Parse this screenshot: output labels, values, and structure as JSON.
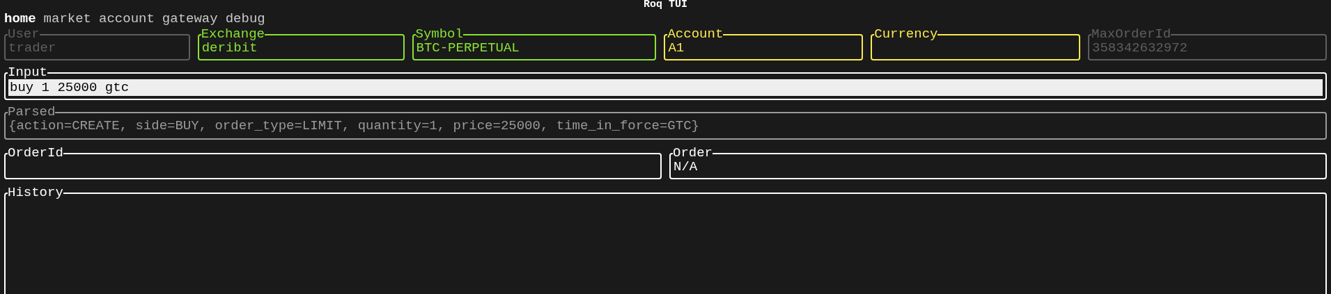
{
  "window": {
    "title": "Roq TUI"
  },
  "tabs": [
    {
      "label": "home",
      "selected": true
    },
    {
      "label": "market",
      "selected": false
    },
    {
      "label": "account",
      "selected": false
    },
    {
      "label": "gateway",
      "selected": false
    },
    {
      "label": "debug",
      "selected": false
    }
  ],
  "fields": [
    {
      "label": "User",
      "value": "trader",
      "color": "#5e5e5e"
    },
    {
      "label": "Exchange",
      "value": "deribit",
      "color": "#8ae234"
    },
    {
      "label": "Symbol",
      "value": "BTC-PERPETUAL",
      "color": "#8ae234"
    },
    {
      "label": "Account",
      "value": "A1",
      "color": "#fce94f"
    },
    {
      "label": "Currency",
      "color": "#fce94f"
    },
    {
      "label": "MaxOrderId",
      "value": "358342632972",
      "color": "#5e5e5e"
    }
  ],
  "input": {
    "label": "Input",
    "value": "buy 1 25000 gtc"
  },
  "parsed": {
    "label": "Parsed",
    "value": "{action=CREATE, side=BUY, order_type=LIMIT, quantity=1, price=25000, time_in_force=GTC}"
  },
  "order_id": {
    "label": "OrderId"
  },
  "order": {
    "label": "Order",
    "value": "N/A"
  },
  "history": {
    "label": "History"
  }
}
